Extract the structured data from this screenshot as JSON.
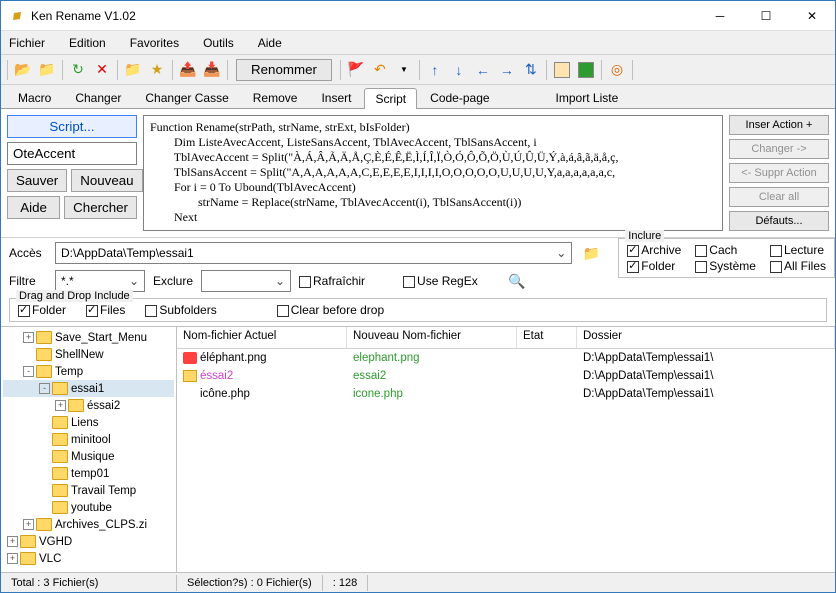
{
  "window": {
    "title": "Ken Rename V1.02"
  },
  "menubar": [
    "Fichier",
    "Edition",
    "Favorites",
    "Outils",
    "Aide"
  ],
  "toolbar": {
    "rename": "Renommer"
  },
  "tabs": [
    "Macro",
    "Changer",
    "Changer Casse",
    "Remove",
    "Insert",
    "Script",
    "Code-page",
    "",
    "Import Liste"
  ],
  "active_tab": 5,
  "script_panel": {
    "script_btn": "Script...",
    "name": "OteAccent",
    "save": "Sauver",
    "new": "Nouveau",
    "help": "Aide",
    "find": "Chercher",
    "code": "Function Rename(strPath, strName, strExt, bIsFolder)\n        Dim ListeAvecAccent, ListeSansAccent, TblAvecAccent, TblSansAccent, i\n        TblAvecAccent = Split(\"À,Á,Â,Ã,Ä,Å,Ç,È,É,Ê,Ë,Ì,Í,Î,Ï,Ò,Ó,Ô,Õ,Ö,Ù,Ú,Û,Ü,Ý,à,á,â,ã,ä,å,ç,\n        TblSansAccent = Split(\"A,A,A,A,A,A,C,E,E,E,E,I,I,I,I,O,O,O,O,O,U,U,U,U,Y,a,a,a,a,a,a,c,\n        For i = 0 To Ubound(TblAvecAccent)\n                strName = Replace(strName, TblAvecAccent(i), TblSansAccent(i))\n        Next"
  },
  "actions": {
    "insert": "Inser Action +",
    "change": "Changer ->",
    "suppr": "<- Suppr Action",
    "clear": "Clear all",
    "defaults": "Défauts..."
  },
  "path": {
    "label": "Accès",
    "value": "D:\\AppData\\Temp\\essai1"
  },
  "filter": {
    "label": "Filtre",
    "value": "*.*",
    "exclude_label": "Exclure",
    "refresh": "Rafraîchir",
    "regex": "Use RegEx"
  },
  "include": {
    "legend": "Inclure",
    "archive": "Archive",
    "cach": "Cach",
    "lecture": "Lecture",
    "folder": "Folder",
    "systeme": "Système",
    "allfiles": "All Files"
  },
  "drag": {
    "legend": "Drag and Drop Include",
    "folder": "Folder",
    "files": "Files",
    "subfolders": "Subfolders",
    "clear": "Clear before drop"
  },
  "tree": [
    {
      "ind": 1,
      "exp": "+",
      "label": "Save_Start_Menu"
    },
    {
      "ind": 1,
      "exp": "",
      "label": "ShellNew"
    },
    {
      "ind": 1,
      "exp": "-",
      "label": "Temp"
    },
    {
      "ind": 2,
      "exp": "-",
      "label": "essai1",
      "sel": true
    },
    {
      "ind": 3,
      "exp": "+",
      "label": "éssai2"
    },
    {
      "ind": 2,
      "exp": "",
      "label": "Liens"
    },
    {
      "ind": 2,
      "exp": "",
      "label": "minitool"
    },
    {
      "ind": 2,
      "exp": "",
      "label": "Musique"
    },
    {
      "ind": 2,
      "exp": "",
      "label": "temp01"
    },
    {
      "ind": 2,
      "exp": "",
      "label": "Travail Temp"
    },
    {
      "ind": 2,
      "exp": "",
      "label": "youtube"
    },
    {
      "ind": 1,
      "exp": "+",
      "label": "Archives_CLPS.zi"
    },
    {
      "ind": 0,
      "exp": "+",
      "label": "VGHD"
    },
    {
      "ind": 0,
      "exp": "+",
      "label": "VLC"
    }
  ],
  "file_cols": {
    "current": "Nom-fichier Actuel",
    "new": "Nouveau Nom-fichier",
    "state": "Etat",
    "folder": "Dossier"
  },
  "files": [
    {
      "icon": "png",
      "name": "éléphant.png",
      "new": "elephant.png",
      "folder": "D:\\AppData\\Temp\\essai1\\"
    },
    {
      "icon": "fd",
      "name": "éssai2",
      "new": "essai2",
      "folder": "D:\\AppData\\Temp\\essai1\\",
      "pink": true
    },
    {
      "icon": "php",
      "name": "icône.php",
      "new": "icone.php",
      "folder": "D:\\AppData\\Temp\\essai1\\"
    }
  ],
  "status": {
    "total": "Total : 3 Fichier(s)",
    "sel": "Sélection?s) : 0 Fichier(s)",
    "len": ": 128"
  }
}
